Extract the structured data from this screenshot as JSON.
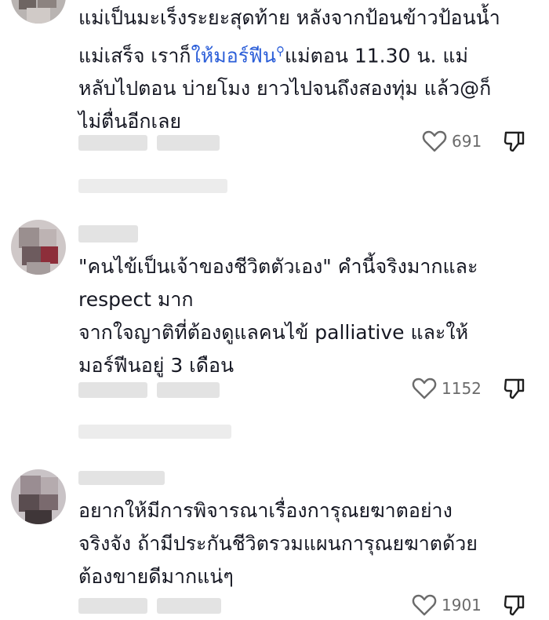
{
  "comments": [
    {
      "lines": [
        [
          "แม่เป็นมะเร็งระยะสุดท้าย หลังจากป้อนข้าวป้อนน้ำ"
        ],
        [
          "แม่เสร็จ เราก็",
          "ให้มอร์ฟีน",
          "แม่ตอน 11.30 น. แม่"
        ],
        [
          "หลับไปตอน บ่ายโมง ยาวไปจนถึงสองทุ่ม แล้ว@ก็"
        ],
        [
          "ไม่ตื่นอีกเลย"
        ]
      ],
      "link_text": "ให้มอร์ฟีน",
      "likes": "691"
    },
    {
      "lines": [
        [
          "\"คนไข้เป็นเจ้าของชีวิตตัวเอง\" คำนี้จริงมากและ"
        ],
        [
          "respect มาก"
        ],
        [
          "จากใจญาติที่ต้องดูแลคนไข้ palliative และให้"
        ],
        [
          "มอร์ฟีนอยู่ 3 เดือน"
        ]
      ],
      "likes": "1152"
    },
    {
      "lines": [
        [
          "อยากให้มีการพิจารณาเรื่องการุณยฆาตอย่าง"
        ],
        [
          "จริงจัง ถ้ามีประกันชีวิตรวมแผนการุณยฆาตด้วย"
        ],
        [
          "ต้องขายดีมากแน่ๆ"
        ]
      ],
      "likes": "1901"
    }
  ],
  "colors": {
    "text": "#161823",
    "link": "#2b5ed8",
    "meta": "#6b6b6b",
    "blur": "#e3e3e3"
  },
  "icons": {
    "like": "heart-outline-icon",
    "dislike": "thumbs-down-outline-icon",
    "link_search": "search-icon"
  }
}
